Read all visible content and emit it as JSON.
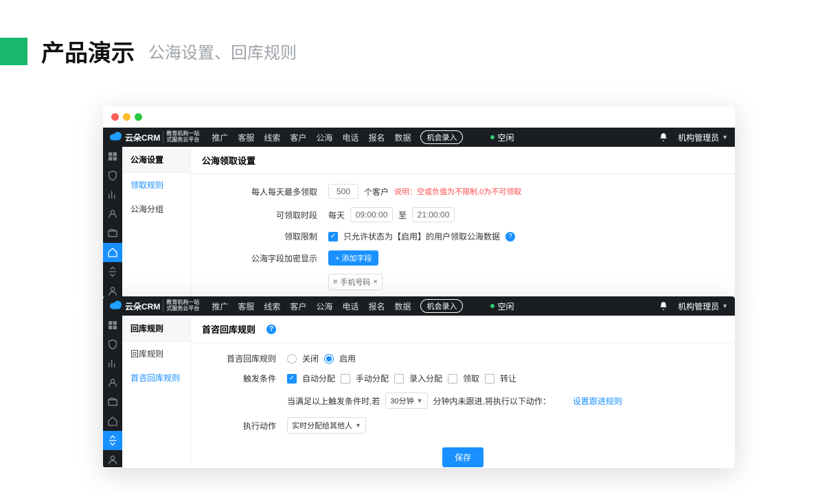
{
  "page": {
    "title_main": "产品演示",
    "title_sub": "公海设置、回库规则"
  },
  "logo_text": "云朵CRM",
  "logo_sub1": "教育机构一站",
  "logo_sub2": "式服务云平台",
  "nav": [
    "推广",
    "客服",
    "线索",
    "客户",
    "公海",
    "电话",
    "报名",
    "数据"
  ],
  "chip": "机会录入",
  "status": "空闲",
  "account": "机构管理员",
  "win1": {
    "side_head": "公海设置",
    "side_items": [
      "领取规则",
      "公海分组"
    ],
    "content_head": "公海领取设置",
    "row1_lbl": "每人每天最多领取",
    "row1_val": "500",
    "row1_unit": "个客户",
    "row1_note_prefix": "说明：",
    "row1_note": "空或负值为不限制,0为不可领取",
    "row2_lbl": "可领取时段",
    "row2_prefix": "每天",
    "row2_from": "09:00:00",
    "row2_to_lbl": "至",
    "row2_to": "21:00:00",
    "row3_lbl": "领取限制",
    "row3_text": "只允许状态为【启用】的用户领取公海数据",
    "row4_lbl": "公海字段加密显示",
    "row4_btn": "+ 添加字段",
    "row4_tag": "手机号码",
    "tag_close": "×"
  },
  "win2": {
    "side_head": "回库规则",
    "side_items": [
      "回库规则",
      "首咨回库规则"
    ],
    "content_head": "首咨回库规则",
    "row1_lbl": "首咨回库规则",
    "radio_off": "关闭",
    "radio_on": "启用",
    "row2_lbl": "触发条件",
    "cb_opts": [
      "自动分配",
      "手动分配",
      "录入分配",
      "领取",
      "转让"
    ],
    "cond_prefix": "当满足以上触发条件时,若",
    "cond_select": "30分钟",
    "cond_suffix": "分钟内未跟进,将执行以下动作：",
    "cond_link": "设置跟进规则",
    "row3_lbl": "执行动作",
    "action_select": "实时分配给其他人",
    "save": "保存"
  }
}
